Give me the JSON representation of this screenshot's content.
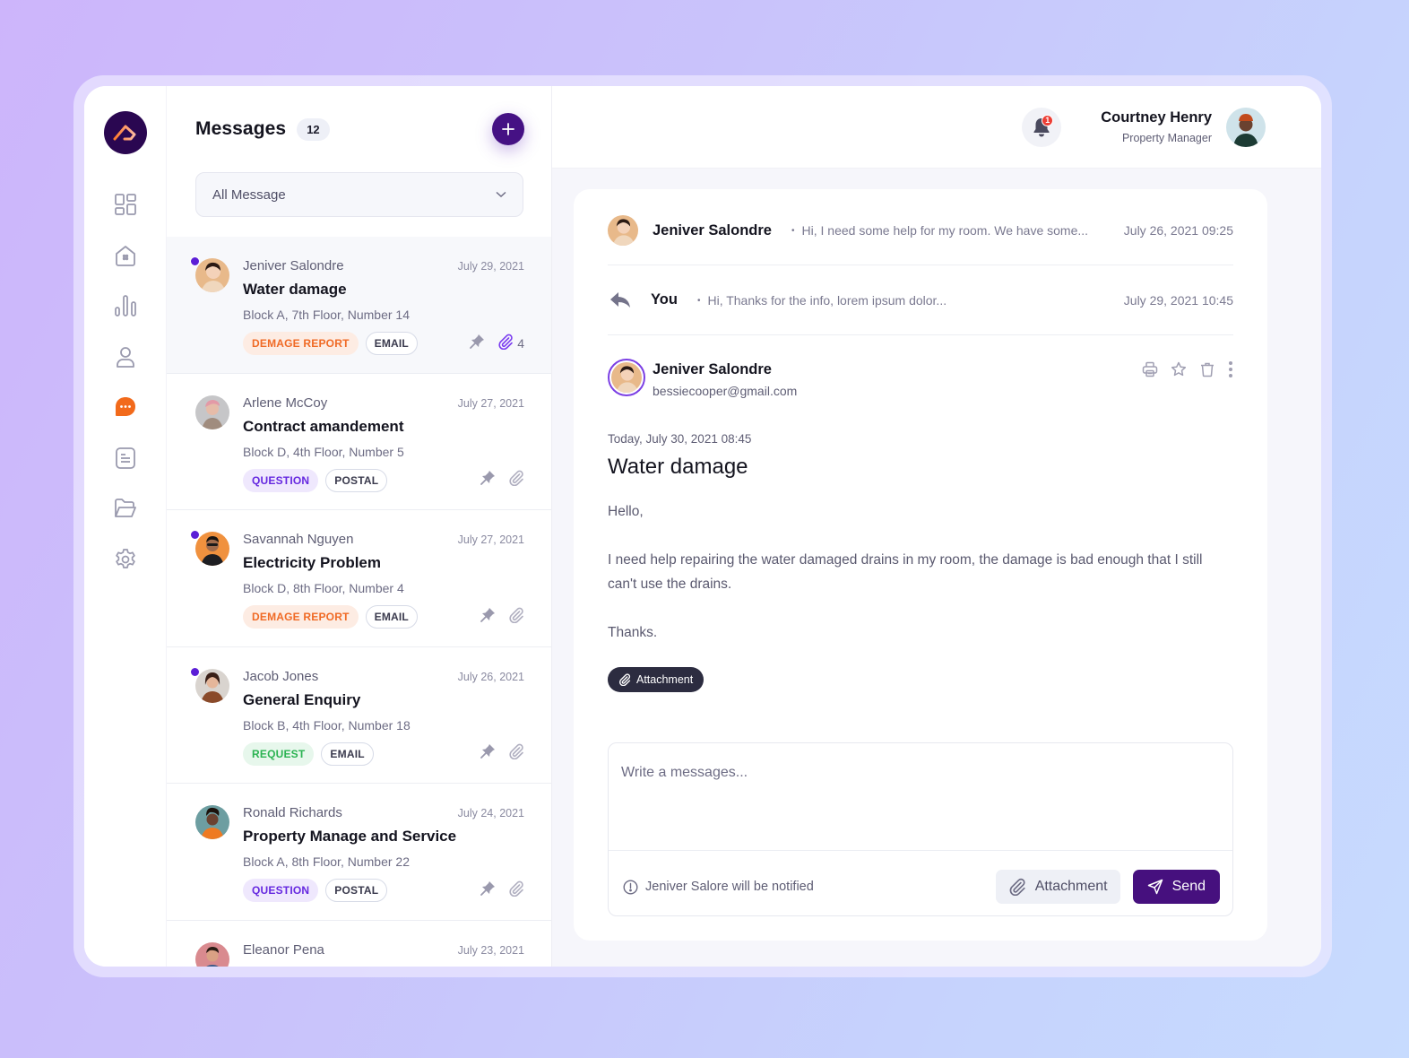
{
  "sidebar": {
    "items": [
      {
        "name": "dashboard",
        "active": false
      },
      {
        "name": "properties",
        "active": false
      },
      {
        "name": "analytics",
        "active": false
      },
      {
        "name": "users",
        "active": false
      },
      {
        "name": "messages",
        "active": true
      },
      {
        "name": "documents",
        "active": false
      },
      {
        "name": "files",
        "active": false
      },
      {
        "name": "settings",
        "active": false
      }
    ],
    "accent": "#f26a1b"
  },
  "list": {
    "title": "Messages",
    "count": "12",
    "filter": "All Message",
    "items": [
      {
        "sender": "Jeniver Salondre",
        "date": "July 29, 2021",
        "subject": "Water damage",
        "address": "Block A, 7th Floor, Number 14",
        "tags": [
          "DEMAGE REPORT",
          "EMAIL"
        ],
        "attachments": "4",
        "unread": true,
        "active": true
      },
      {
        "sender": "Arlene McCoy",
        "date": "July 27, 2021",
        "subject": "Contract amandement",
        "address": "Block D, 4th Floor, Number 5",
        "tags": [
          "QUESTION",
          "POSTAL"
        ],
        "unread": false
      },
      {
        "sender": "Savannah Nguyen",
        "date": "July 27, 2021",
        "subject": "Electricity Problem",
        "address": "Block D, 8th Floor, Number 4",
        "tags": [
          "DEMAGE REPORT",
          "EMAIL"
        ],
        "unread": true
      },
      {
        "sender": "Jacob Jones",
        "date": "July 26, 2021",
        "subject": "General Enquiry",
        "address": "Block B, 4th Floor, Number 18",
        "tags": [
          "REQUEST",
          "EMAIL"
        ],
        "unread": true
      },
      {
        "sender": "Ronald Richards",
        "date": "July 24, 2021",
        "subject": "Property Manage and Service",
        "address": "Block A, 8th Floor, Number 22",
        "tags": [
          "QUESTION",
          "POSTAL"
        ],
        "unread": false
      },
      {
        "sender": "Eleanor Pena",
        "date": "July 23, 2021"
      }
    ]
  },
  "header": {
    "notifications": "1",
    "user_name": "Courtney Henry",
    "user_role": "Property Manager"
  },
  "thread": {
    "rows": [
      {
        "name": "Jeniver Salondre",
        "snippet": "Hi, I need some help for my room. We have some...",
        "date": "July 26, 2021 09:25"
      },
      {
        "name": "You",
        "snippet": "Hi, Thanks for the info, lorem ipsum dolor...",
        "date": "July 29, 2021 10:45"
      }
    ],
    "detail": {
      "name": "Jeniver Salondre",
      "email": "bessiecooper@gmail.com",
      "time": "Today, July 30, 2021 08:45",
      "subject": "Water damage",
      "body": [
        "Hello,",
        "I need help repairing the water damaged drains in my room, the damage is bad enough that I still can't use the drains.",
        "Thanks."
      ],
      "attachment_label": "Attachment"
    },
    "composer": {
      "placeholder": "Write a messages...",
      "value": "",
      "notice": "Jeniver Salore will be notified",
      "attach_label": "Attachment",
      "send_label": "Send"
    }
  }
}
